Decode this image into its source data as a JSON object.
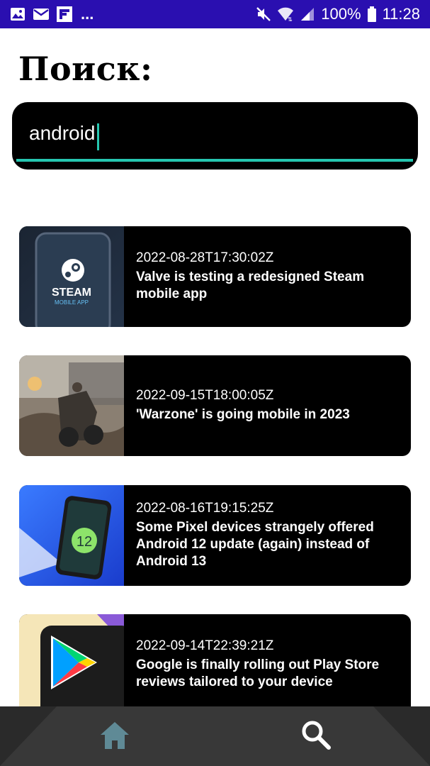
{
  "status_bar": {
    "overflow": "...",
    "battery": "100%",
    "time": "11:28",
    "icons": [
      "gallery-icon",
      "mail-icon",
      "flipboard-icon",
      "mute-icon",
      "wifi-icon",
      "signal-icon",
      "battery-icon"
    ]
  },
  "page": {
    "title": "Поиск:"
  },
  "search": {
    "value": "android"
  },
  "articles": [
    {
      "date": "2022-08-28T17:30:02Z",
      "title": "Valve is testing a redesigned Steam mobile app",
      "thumb_text": "STEAM",
      "thumb_subtext": "MOBILE APP"
    },
    {
      "date": "2022-09-15T18:00:05Z",
      "title": "'Warzone' is going mobile in 2023"
    },
    {
      "date": "2022-08-16T19:15:25Z",
      "title": "Some Pixel devices strangely offered Android 12 update (again) instead of Android 13",
      "thumb_text": "12"
    },
    {
      "date": "2022-09-14T22:39:21Z",
      "title": "Google is finally rolling out Play Store reviews tailored to your device"
    }
  ],
  "nav": {
    "items": [
      "home-icon",
      "search-icon"
    ]
  },
  "colors": {
    "status_bar": "#2a0fb0",
    "accent": "#26c6b0",
    "card_bg": "#000000",
    "nav_bg": "#383838",
    "home_icon": "#5f8a96"
  }
}
